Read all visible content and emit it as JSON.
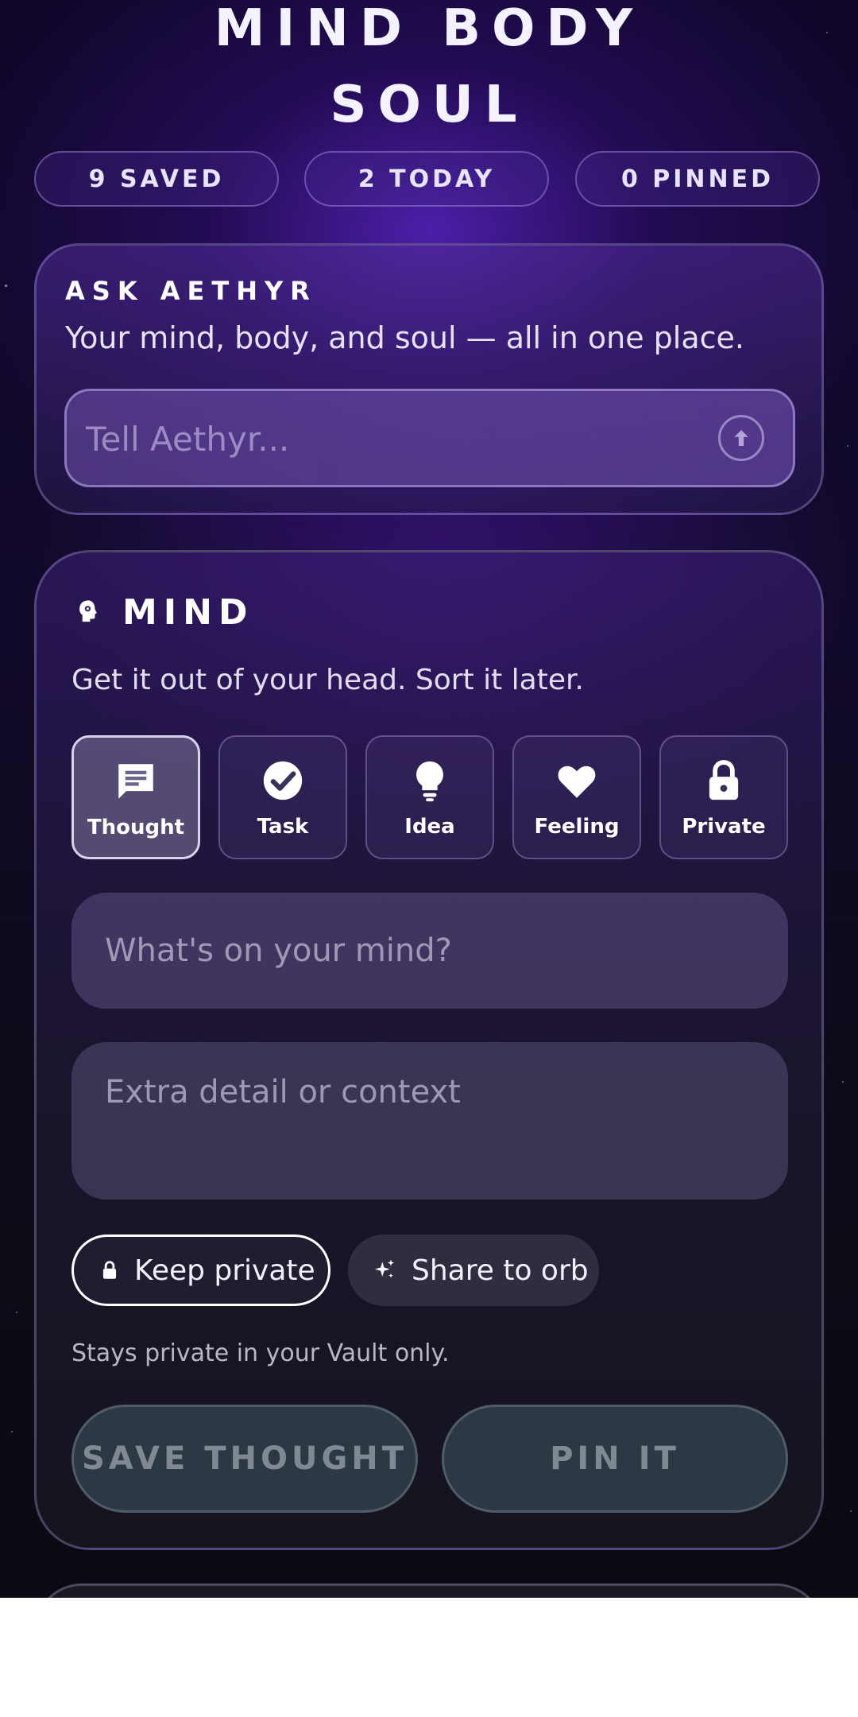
{
  "brand": {
    "line1": "MIND BODY",
    "line2": "SOUL"
  },
  "stats": [
    {
      "label": "9 SAVED"
    },
    {
      "label": "2 TODAY"
    },
    {
      "label": "0 PINNED"
    }
  ],
  "ask": {
    "eyebrow": "ASK AETHYR",
    "tagline": "Your mind, body, and soul — all in one place.",
    "placeholder": "Tell Aethyr...",
    "send_icon": "arrow-up-circle-icon"
  },
  "mind": {
    "title": "MIND",
    "icon": "head-gear-icon",
    "subtitle": "Get it out of your head. Sort it later.",
    "types": [
      {
        "label": "Thought",
        "icon": "chat-bubble-icon",
        "active": true
      },
      {
        "label": "Task",
        "icon": "check-circle-icon",
        "active": false
      },
      {
        "label": "Idea",
        "icon": "lightbulb-icon",
        "active": false
      },
      {
        "label": "Feeling",
        "icon": "heart-icon",
        "active": false
      },
      {
        "label": "Private",
        "icon": "lock-icon",
        "active": false
      }
    ],
    "input_placeholder": "What's on your mind?",
    "detail_placeholder": "Extra detail or context",
    "visibility": {
      "keep_private": "Keep private",
      "share_to_orb": "Share to orb",
      "selected": "keep_private"
    },
    "privacy_note": "Stays private in your Vault only.",
    "actions": {
      "save": "SAVE THOUGHT",
      "pin": "PIN IT"
    }
  },
  "colors": {
    "accent_purple": "#5822be",
    "text_light": "#f4f2ff",
    "action_bg": "#344450"
  }
}
